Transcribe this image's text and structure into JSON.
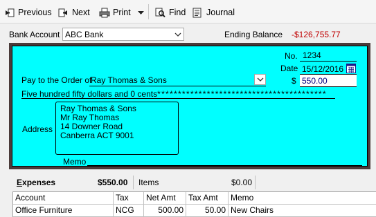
{
  "toolbar": {
    "previous_label": "Previous",
    "next_label": "Next",
    "print_label": "Print",
    "find_label": "Find",
    "journal_label": "Journal"
  },
  "account": {
    "bank_account_label": "Bank Account",
    "bank_account_value": "ABC Bank",
    "ending_balance_label": "Ending Balance",
    "ending_balance_value": "-$126,755.77"
  },
  "cheque": {
    "no_label": "No.",
    "no_value": "1234",
    "date_label": "Date",
    "date_value": "15/12/2016",
    "pay_to_label": "Pay to the Order of",
    "pay_to_value": "Ray Thomas & Sons",
    "amount_symbol": "$",
    "amount_value": "550.00",
    "amount_words": "Five hundred fifty dollars and 0 cents",
    "amount_words_fill": "*****************************************",
    "address_label": "Address",
    "address_lines": [
      "Ray Thomas & Sons",
      "Mr Ray Thomas",
      "14 Downer Road",
      "Canberra ACT 9001"
    ],
    "memo_label": "Memo",
    "memo_value": ""
  },
  "split": {
    "expenses_label": "Expenses",
    "expenses_amount": "$550.00",
    "items_label": "Items",
    "items_amount": "$0.00"
  },
  "grid": {
    "columns": [
      "Account",
      "Tax",
      "Net Amt",
      "Tax Amt",
      "Memo"
    ],
    "rows": [
      [
        "Office Furniture",
        "NCG",
        "500.00",
        "50.00",
        "New Chairs"
      ]
    ]
  },
  "colors": {
    "cheque_background": "#00ffff",
    "cheque_frame": "#4a3b3a",
    "negative_balance": "#c00000",
    "amount_text": "#000080"
  },
  "icons": [
    "previous-icon",
    "next-icon",
    "print-icon",
    "dropdown-arrow-icon",
    "find-icon",
    "journal-icon",
    "chevron-down-icon",
    "calendar-icon"
  ]
}
